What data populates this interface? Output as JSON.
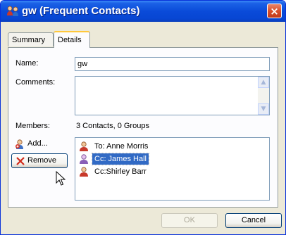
{
  "window": {
    "title": "gw (Frequent Contacts)",
    "close_glyph": "×",
    "icon": "contacts-group-icon"
  },
  "tabs": [
    {
      "label": "Summary",
      "active": false
    },
    {
      "label": "Details",
      "active": true
    }
  ],
  "form": {
    "name_label": "Name:",
    "name_value": "gw",
    "comments_label": "Comments:",
    "comments_value": "",
    "members_label": "Members:",
    "members_summary": "3 Contacts, 0 Groups"
  },
  "actions": {
    "add_label": "Add...",
    "remove_label": "Remove"
  },
  "members": [
    {
      "text": "To: Anne Morris",
      "selected": false,
      "icon": "contact-person-icon"
    },
    {
      "text": "Cc: James Hall",
      "selected": true,
      "icon": "contact-group-person-icon"
    },
    {
      "text": "Cc:Shirley Barr",
      "selected": false,
      "icon": "contact-person-icon"
    }
  ],
  "footer": {
    "ok_label": "OK",
    "ok_enabled": false,
    "cancel_label": "Cancel"
  },
  "colors": {
    "titlebar": "#0a4bd9",
    "selection": "#316ac5",
    "close": "#d9502b"
  }
}
